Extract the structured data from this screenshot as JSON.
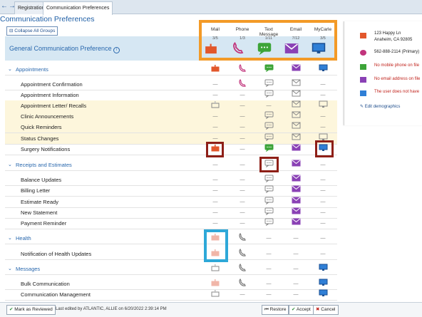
{
  "tabs": [
    {
      "label": "Registration"
    },
    {
      "label": "Communication Preferences"
    }
  ],
  "page_title": "Communication Preferences",
  "collapse_button": "Collapse All Groups",
  "general": {
    "title": "General Communication Preference",
    "info_icon": "info-icon"
  },
  "columns": [
    {
      "name": "Mail",
      "count": "3/5",
      "icon": "mailbox-icon"
    },
    {
      "name": "Phone",
      "count": "1/3",
      "icon": "phone-icon"
    },
    {
      "name": "Text Message",
      "count": "1/11",
      "icon": "text-message-icon"
    },
    {
      "name": "Email",
      "count": "7/12",
      "icon": "email-icon"
    },
    {
      "name": "MyCarle",
      "count": "3/5",
      "icon": "mycarle-monitor-icon"
    }
  ],
  "rows": [
    {
      "label": "Appointments",
      "group": true,
      "yellow": false,
      "cells": [
        "mail-on",
        "phone-on",
        "text-on",
        "email-on",
        "mycarle-on"
      ]
    },
    {
      "label": "Appointment Confirmation",
      "group": false,
      "yellow": false,
      "cells": [
        "—",
        "phone-on",
        "text-off",
        "email-off",
        "—"
      ]
    },
    {
      "label": "Appointment Information",
      "group": false,
      "yellow": false,
      "cells": [
        "—",
        "—",
        "text-off",
        "email-off",
        "—"
      ]
    },
    {
      "label": "Appointment Letter/ Recalls",
      "group": false,
      "yellow": true,
      "cells": [
        "mail-off",
        "—",
        "—",
        "email-off",
        "mycarle-off"
      ]
    },
    {
      "label": "Clinic Announcements",
      "group": false,
      "yellow": true,
      "cells": [
        "—",
        "—",
        "text-off",
        "email-off",
        "—"
      ]
    },
    {
      "label": "Quick Reminders",
      "group": false,
      "yellow": true,
      "cells": [
        "—",
        "—",
        "text-off",
        "email-off",
        "—"
      ]
    },
    {
      "label": "Status Changes",
      "group": false,
      "yellow": true,
      "cells": [
        "—",
        "—",
        "text-off",
        "email-off",
        "mycarle-off"
      ]
    },
    {
      "label": "Surgery Notifications",
      "group": false,
      "yellow": false,
      "cells": [
        "mail-on",
        "—",
        "text-on",
        "email-on",
        "mycarle-on"
      ]
    },
    {
      "label": "Receipts and Estimates",
      "group": true,
      "yellow": false,
      "cells": [
        "—",
        "—",
        "text-off",
        "email-on",
        "—"
      ]
    },
    {
      "label": "Balance Updates",
      "group": false,
      "yellow": false,
      "cells": [
        "—",
        "—",
        "text-off",
        "email-on",
        "—"
      ]
    },
    {
      "label": "Billing Letter",
      "group": false,
      "yellow": false,
      "cells": [
        "—",
        "—",
        "text-off",
        "email-on",
        "—"
      ]
    },
    {
      "label": "Estimate Ready",
      "group": false,
      "yellow": false,
      "cells": [
        "—",
        "—",
        "text-off",
        "email-on",
        "—"
      ]
    },
    {
      "label": "New Statement",
      "group": false,
      "yellow": false,
      "cells": [
        "—",
        "—",
        "text-off",
        "email-on",
        "—"
      ]
    },
    {
      "label": "Payment Reminder",
      "group": false,
      "yellow": false,
      "cells": [
        "—",
        "—",
        "text-off",
        "email-on",
        "—"
      ]
    },
    {
      "label": "Health",
      "group": true,
      "yellow": false,
      "cells": [
        "mail-faded",
        "phone-off",
        "—",
        "—",
        "—"
      ]
    },
    {
      "label": "Notification of Health Updates",
      "group": false,
      "yellow": false,
      "cells": [
        "mail-faded",
        "phone-off",
        "—",
        "—",
        "—"
      ]
    },
    {
      "label": "Messages",
      "group": true,
      "yellow": false,
      "cells": [
        "mail-off",
        "phone-off",
        "—",
        "—",
        "mycarle-on"
      ]
    },
    {
      "label": "Bulk Communication",
      "group": false,
      "yellow": false,
      "cells": [
        "mail-faded",
        "phone-off",
        "—",
        "—",
        "mycarle-on"
      ]
    },
    {
      "label": "Communication Management",
      "group": false,
      "yellow": false,
      "cells": [
        "mail-off",
        "—",
        "—",
        "—",
        "mycarle-on"
      ]
    }
  ],
  "sidebar": {
    "address_line1": "123 Happy Ln",
    "address_line2": "Anaheim,  CA 92805",
    "phone": "562-888-2114 (Primary)",
    "no_mobile": "No mobile phone on file",
    "no_email": "No email address on file",
    "no_mycarle": "The user does not have",
    "edit_link": "Edit demographics"
  },
  "footer": {
    "mark_reviewed": "Mark as Reviewed",
    "last_edited": "Last edited by ATLANTIC, ALLIE on 6/20/2022 2:39:14 PM",
    "restore": "Restore",
    "accept": "Accept",
    "cancel": "Cancel"
  },
  "colors": {
    "mail": "#e2572b",
    "phone": "#c1347c",
    "text": "#3ca438",
    "email": "#8a41b5",
    "mycarle": "#2f7fd6",
    "accent": "#1f5fa6"
  }
}
